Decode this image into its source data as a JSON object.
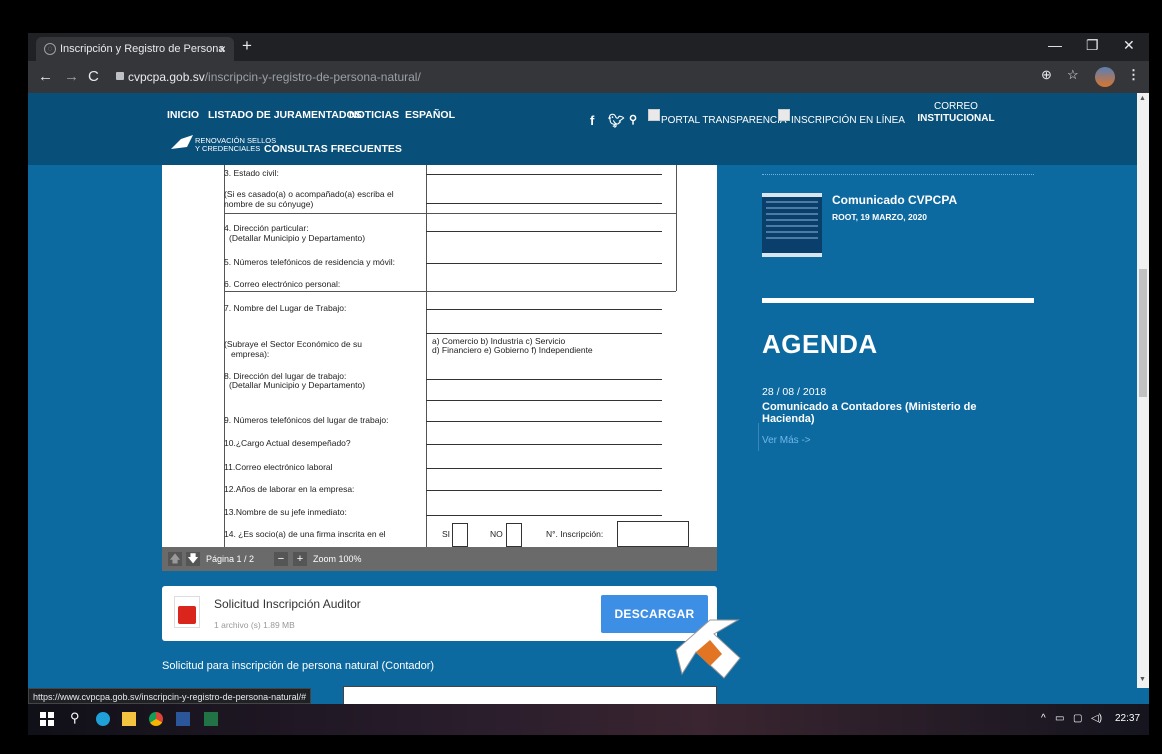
{
  "browser": {
    "tab_title": "Inscripción y Registro de Persona",
    "tab_close": "×",
    "new_tab": "+",
    "url_domain": "cvpcpa.gob.sv",
    "url_path": "/inscripcin-y-registro-de-persona-natural/",
    "status_url": "https://www.cvpcpa.gob.sv/inscripcin-y-registro-de-persona-natural/#"
  },
  "nav": {
    "items": [
      "INICIO",
      "LISTADO DE JURAMENTADOS",
      "NOTICIAS",
      "ESPAÑOL"
    ],
    "portal": "PORTAL TRANSPARENCIA",
    "inscripcion": "INSCRIPCIÓN EN LÍNEA",
    "correo_line1": "CORREO",
    "correo_line2": "INSTITUCIONAL",
    "renov_line1": "RENOVACIÓN SELLOS",
    "renov_line2": "Y CREDENCIALES",
    "faq": "CONSULTAS FRECUENTES"
  },
  "form": {
    "r1": "3. Estado civil:",
    "r2a": "(Si es casado(a) o acompañado(a) escriba el",
    "r2b": "nombre de su cónyuge)",
    "r3a": "4. Dirección particular:",
    "r3b": "(Detallar Municipio y Departamento)",
    "r4": "5. Números telefónicos de residencia y móvil:",
    "r5": "6. Correo electrónico personal:",
    "r6": "7. Nombre del Lugar de Trabajo:",
    "r7a": "(Subraye el Sector Económico de su",
    "r7b": "empresa):",
    "r7c": "a) Comercio b) Industria c) Servicio",
    "r7d": "d) Financiero e) Gobierno f) Independiente",
    "r8a": "8. Dirección del lugar de trabajo:",
    "r8b": "(Detallar Municipio y Departamento)",
    "r9": "9. Números telefónicos del lugar de trabajo:",
    "r10": "10.¿Cargo Actual desempeñado?",
    "r11": "11.Correo electrónico laboral",
    "r12": "12.Años de laborar en la empresa:",
    "r13": "13.Nombre de su jefe inmediato:",
    "r14": "14. ¿Es socio(a) de una firma inscrita en el",
    "si": "SI",
    "no": "NO",
    "ninsc": "N°. Inscripción:"
  },
  "pdfbar": {
    "page": "Página 1 / 2",
    "minus": "−",
    "plus": "+",
    "zoom": "Zoom 100%"
  },
  "download": {
    "title": "Solicitud Inscripción Auditor",
    "meta": "1 archivo (s)  1.89 MB",
    "button": "DESCARGAR"
  },
  "below_text": "Solicitud para inscripción de persona natural (Contador)",
  "sidebar": {
    "news_title": "Comunicado CVPCPA",
    "news_meta": "ROOT, 19 MARZO, 2020",
    "agenda": "AGENDA",
    "agenda_date": "28 / 08 / 2018",
    "agenda_title": "Comunicado a Contadores (Ministerio de Hacienda)",
    "agenda_more": "Ver Más ->"
  },
  "taskbar": {
    "time": "22:37"
  },
  "colors": {
    "site_bg": "#0d6aa0",
    "header_bg": "#08507a",
    "button_blue": "#3d8ee5"
  }
}
